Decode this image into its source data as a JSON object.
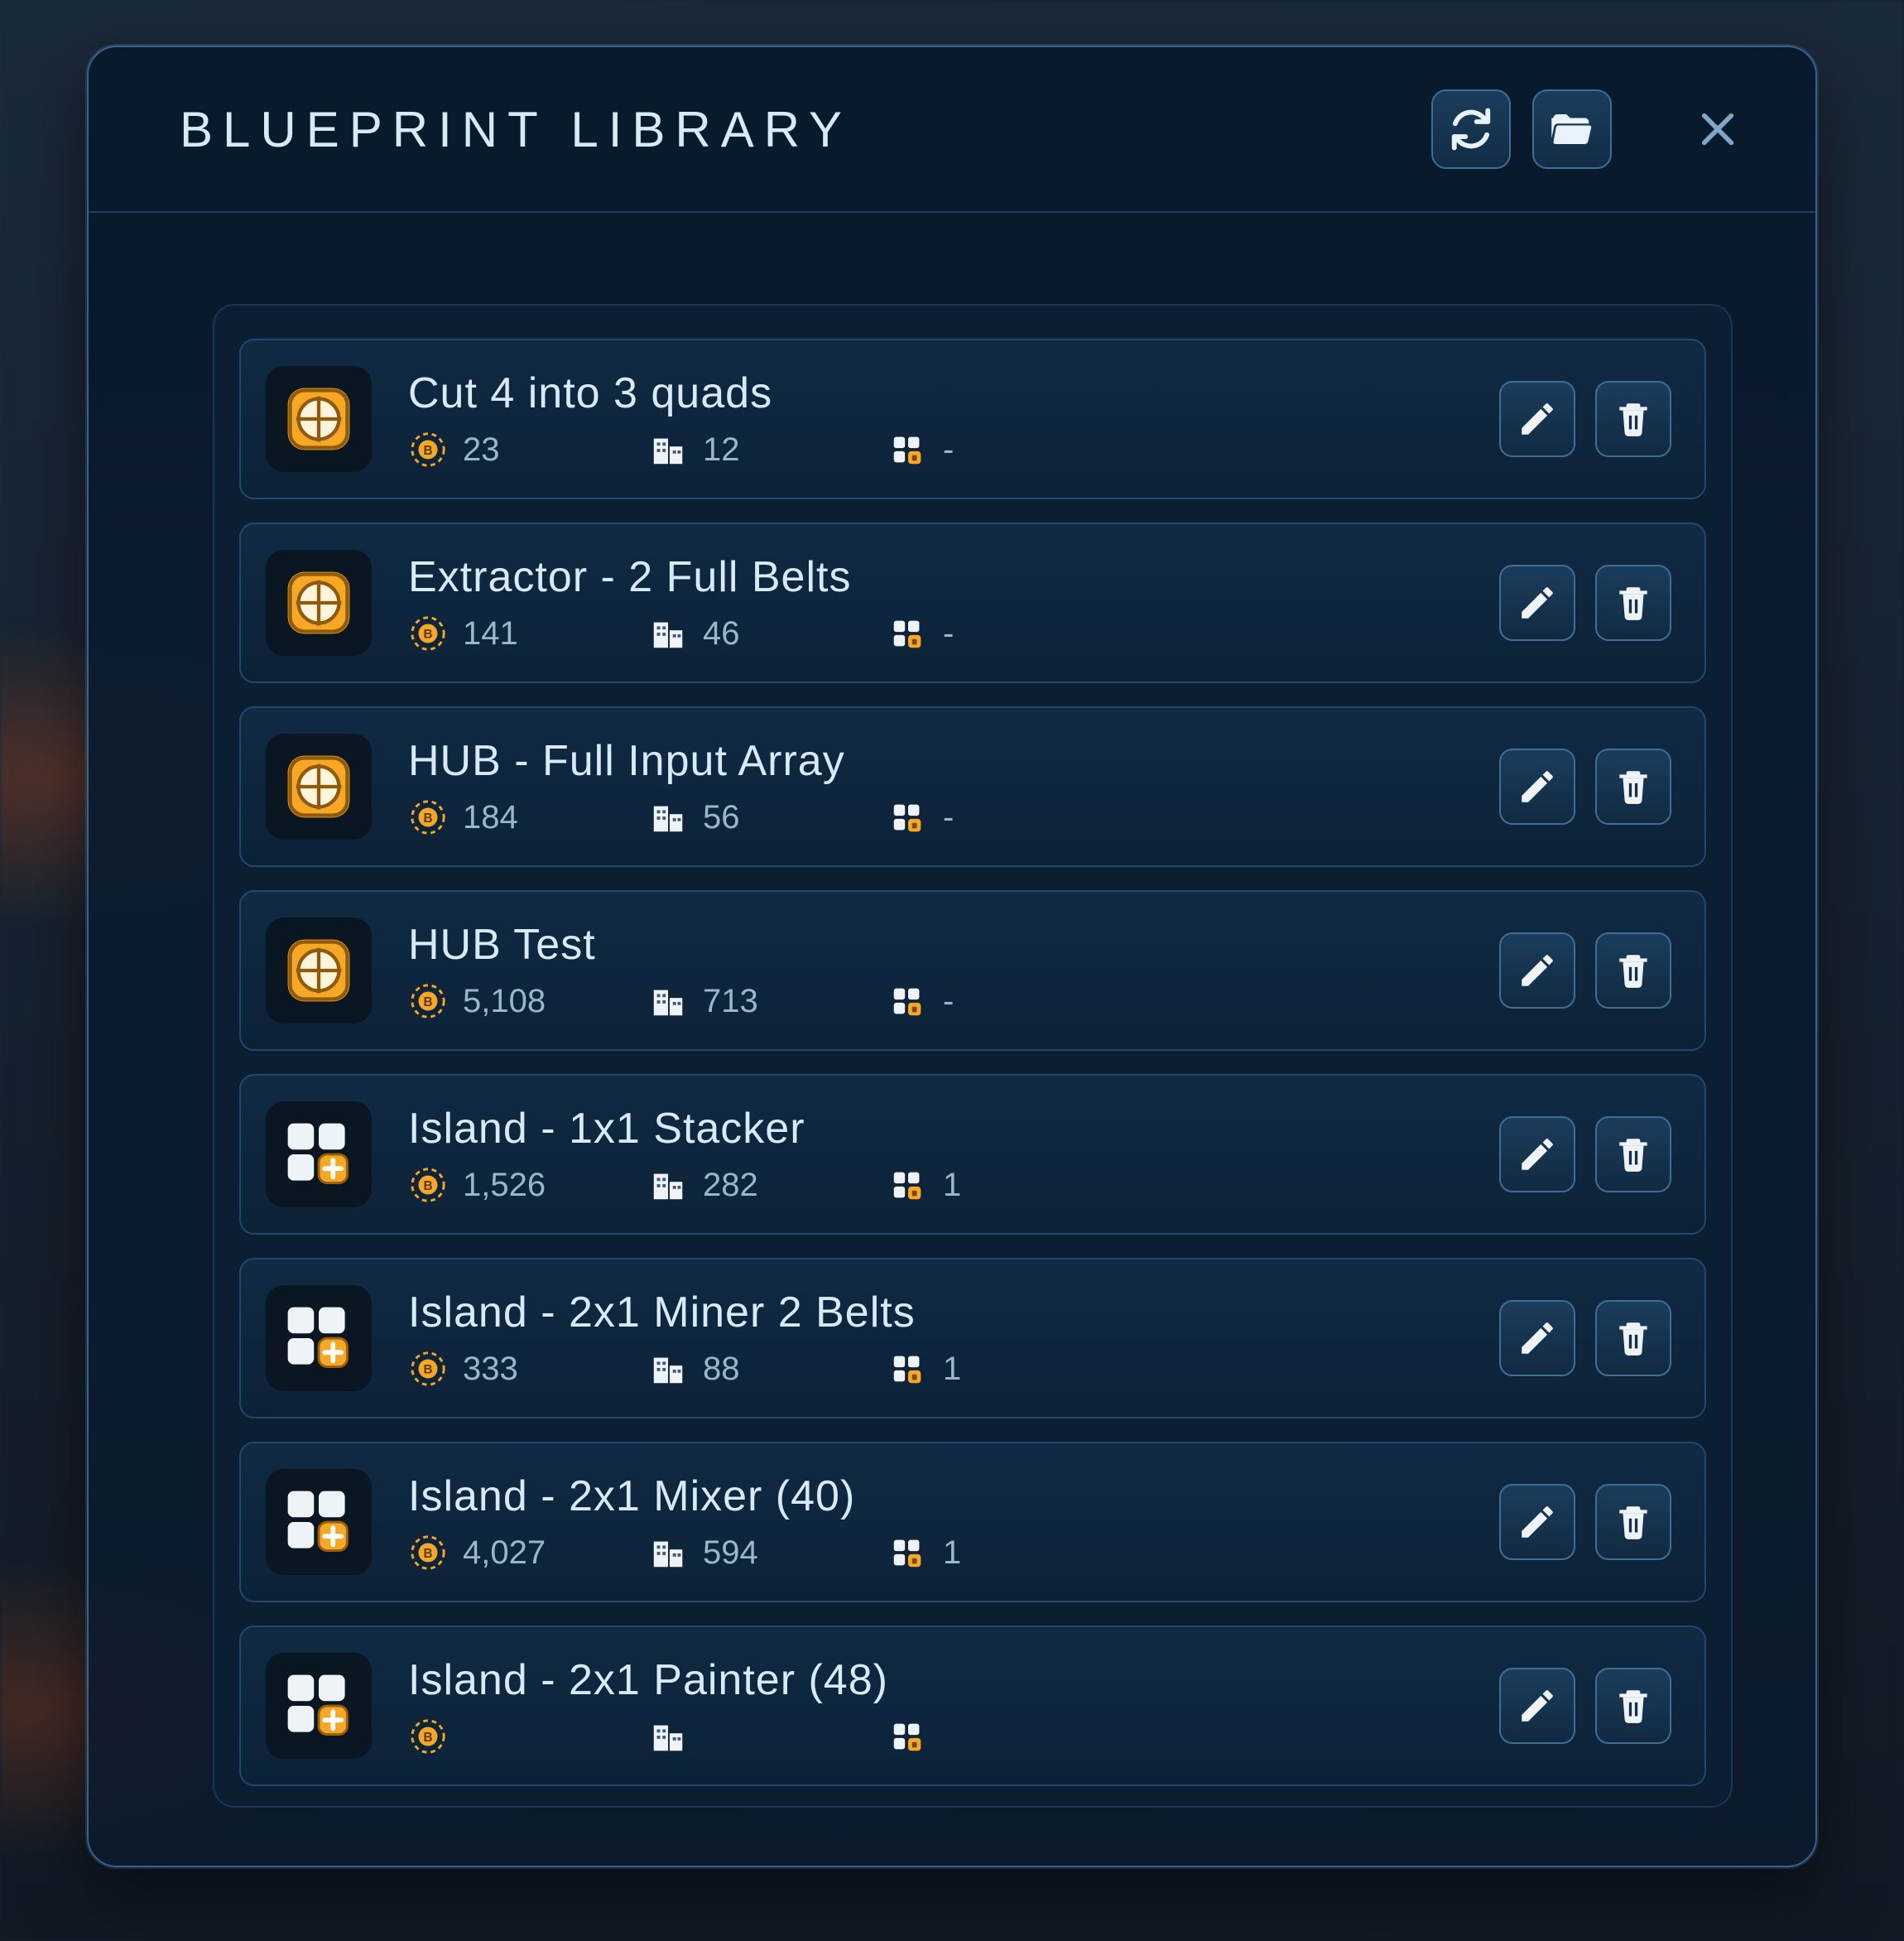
{
  "header": {
    "title": "BLUEPRINT LIBRARY"
  },
  "blueprints": [
    {
      "name": "Cut 4 into 3 quads",
      "icon": "building",
      "cost": "23",
      "buildings": "12",
      "islands": "-"
    },
    {
      "name": "Extractor - 2 Full Belts",
      "icon": "building",
      "cost": "141",
      "buildings": "46",
      "islands": "-"
    },
    {
      "name": "HUB - Full Input Array",
      "icon": "building",
      "cost": "184",
      "buildings": "56",
      "islands": "-"
    },
    {
      "name": "HUB Test",
      "icon": "building",
      "cost": "5,108",
      "buildings": "713",
      "islands": "-"
    },
    {
      "name": "Island - 1x1 Stacker",
      "icon": "island",
      "cost": "1,526",
      "buildings": "282",
      "islands": "1"
    },
    {
      "name": "Island - 2x1 Miner 2 Belts",
      "icon": "island",
      "cost": "333",
      "buildings": "88",
      "islands": "1"
    },
    {
      "name": "Island - 2x1 Mixer (40)",
      "icon": "island",
      "cost": "4,027",
      "buildings": "594",
      "islands": "1"
    },
    {
      "name": "Island - 2x1 Painter (48)",
      "icon": "island",
      "cost": "",
      "buildings": "",
      "islands": ""
    }
  ]
}
